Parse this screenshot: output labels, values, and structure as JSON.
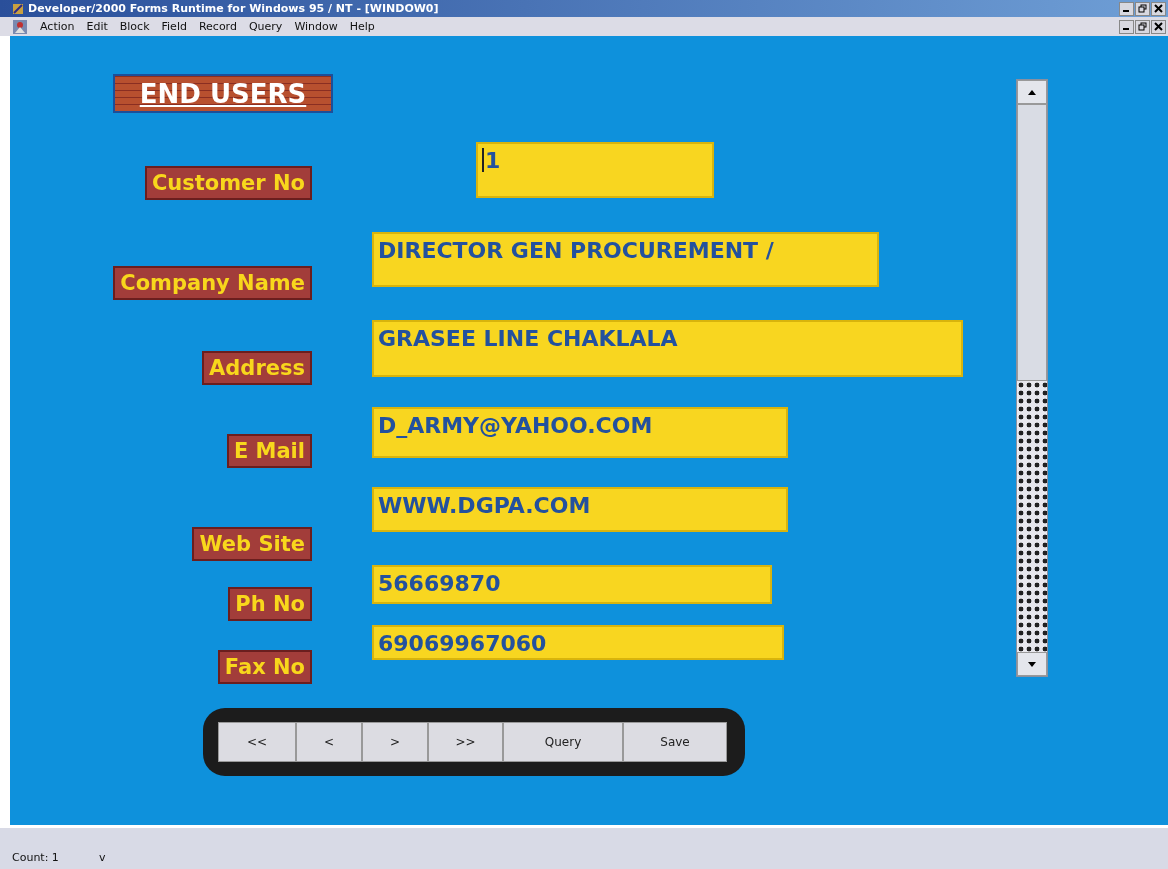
{
  "window": {
    "title": "Developer/2000 Forms Runtime for Windows 95 / NT - [WINDOW0]"
  },
  "menu": [
    "Action",
    "Edit",
    "Block",
    "Field",
    "Record",
    "Query",
    "Window",
    "Help"
  ],
  "form": {
    "title": "END USERS",
    "fields": [
      {
        "label": "Customer No",
        "value": "1",
        "focused": true
      },
      {
        "label": "Company Name",
        "value": "DIRECTOR GEN PROCUREMENT /",
        "focused": false
      },
      {
        "label": "Address",
        "value": "GRASEE LINE CHAKLALA",
        "focused": false
      },
      {
        "label": "E Mail",
        "value": "D_ARMY@YAHOO.COM",
        "focused": false
      },
      {
        "label": "Web Site",
        "value": "WWW.DGPA.COM",
        "focused": false
      },
      {
        "label": "Ph No",
        "value": "56669870",
        "focused": false
      },
      {
        "label": "Fax No",
        "value": "69069967060",
        "focused": false
      }
    ],
    "buttons": [
      "<<",
      "<",
      ">",
      ">>",
      "Query",
      "Save"
    ]
  },
  "status_bar": {
    "count": "Count: 1",
    "mode": "v"
  }
}
